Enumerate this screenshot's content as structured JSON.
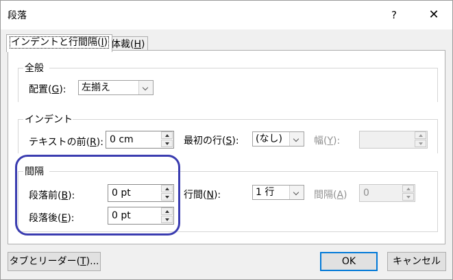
{
  "dialog": {
    "title": "段落",
    "help_glyph": "?",
    "close_glyph": "✕"
  },
  "tabs": [
    {
      "label_pre": "インデントと行間隔(",
      "key": "I",
      "label_post": ")",
      "active": true
    },
    {
      "label_pre": "体裁(",
      "key": "H",
      "label_post": ")",
      "active": false
    }
  ],
  "general": {
    "title": "全般",
    "alignment_label_pre": "配置(",
    "alignment_key": "G",
    "alignment_label_post": "):",
    "alignment_value": "左揃え"
  },
  "indent": {
    "title": "インデント",
    "before_label_pre": "テキストの前(",
    "before_key": "R",
    "before_label_post": "):",
    "before_value": "0 cm",
    "first_line_label_pre": "最初の行(",
    "first_line_key": "S",
    "first_line_label_post": "):",
    "first_line_value": "(なし)",
    "by_label_pre": "幅(",
    "by_key": "Y",
    "by_label_post": "):",
    "by_value": ""
  },
  "spacing": {
    "title": "間隔",
    "before_label_pre": "段落前(",
    "before_key": "B",
    "before_label_post": "):",
    "before_value": "0 pt",
    "after_label_pre": "段落後(",
    "after_key": "E",
    "after_label_post": "):",
    "after_value": "0 pt",
    "line_label_pre": "行間(",
    "line_key": "N",
    "line_label_post": "):",
    "line_value": "1 行",
    "at_label_pre": "間隔(",
    "at_key": "A",
    "at_label_post": ")",
    "at_value": "0"
  },
  "footer": {
    "tabs_button_pre": "タブとリーダー(",
    "tabs_button_key": "T",
    "tabs_button_post": ")...",
    "ok_label": "OK",
    "cancel_label": "キャンセル"
  },
  "colors": {
    "annotation": "#3a3cb0",
    "default_button_border": "#0078d7"
  }
}
